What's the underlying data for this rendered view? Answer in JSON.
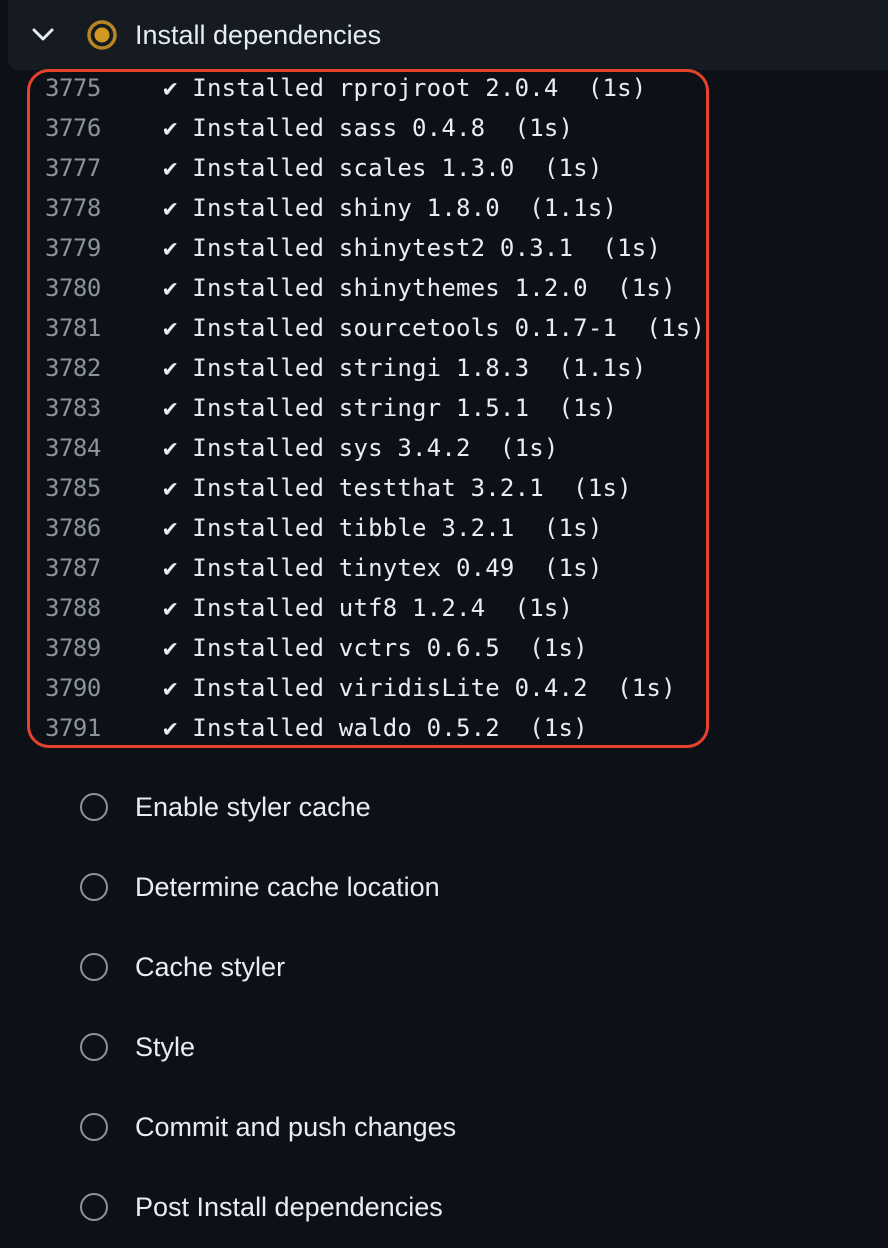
{
  "current_step": {
    "title": "Install dependencies",
    "status_icon": "in-progress-icon",
    "expand_icon": "chevron-down-icon",
    "status_color": "#d29922"
  },
  "log_lines": [
    {
      "number": "3775",
      "text": "✔ Installed rprojroot 2.0.4  (1s)"
    },
    {
      "number": "3776",
      "text": "✔ Installed sass 0.4.8  (1s)"
    },
    {
      "number": "3777",
      "text": "✔ Installed scales 1.3.0  (1s)"
    },
    {
      "number": "3778",
      "text": "✔ Installed shiny 1.8.0  (1.1s)"
    },
    {
      "number": "3779",
      "text": "✔ Installed shinytest2 0.3.1  (1s)"
    },
    {
      "number": "3780",
      "text": "✔ Installed shinythemes 1.2.0  (1s)"
    },
    {
      "number": "3781",
      "text": "✔ Installed sourcetools 0.1.7-1  (1s)"
    },
    {
      "number": "3782",
      "text": "✔ Installed stringi 1.8.3  (1.1s)"
    },
    {
      "number": "3783",
      "text": "✔ Installed stringr 1.5.1  (1s)"
    },
    {
      "number": "3784",
      "text": "✔ Installed sys 3.4.2  (1s)"
    },
    {
      "number": "3785",
      "text": "✔ Installed testthat 3.2.1  (1s)"
    },
    {
      "number": "3786",
      "text": "✔ Installed tibble 3.2.1  (1s)"
    },
    {
      "number": "3787",
      "text": "✔ Installed tinytex 0.49  (1s)"
    },
    {
      "number": "3788",
      "text": "✔ Installed utf8 1.2.4  (1s)"
    },
    {
      "number": "3789",
      "text": "✔ Installed vctrs 0.6.5  (1s)"
    },
    {
      "number": "3790",
      "text": "✔ Installed viridisLite 0.4.2  (1s)"
    },
    {
      "number": "3791",
      "text": "✔ Installed waldo 0.5.2  (1s)"
    }
  ],
  "highlight_color": "#e5432d",
  "pending_steps": [
    {
      "label": "Enable styler cache"
    },
    {
      "label": "Determine cache location"
    },
    {
      "label": "Cache styler"
    },
    {
      "label": "Style"
    },
    {
      "label": "Commit and push changes"
    },
    {
      "label": "Post Install dependencies"
    }
  ]
}
